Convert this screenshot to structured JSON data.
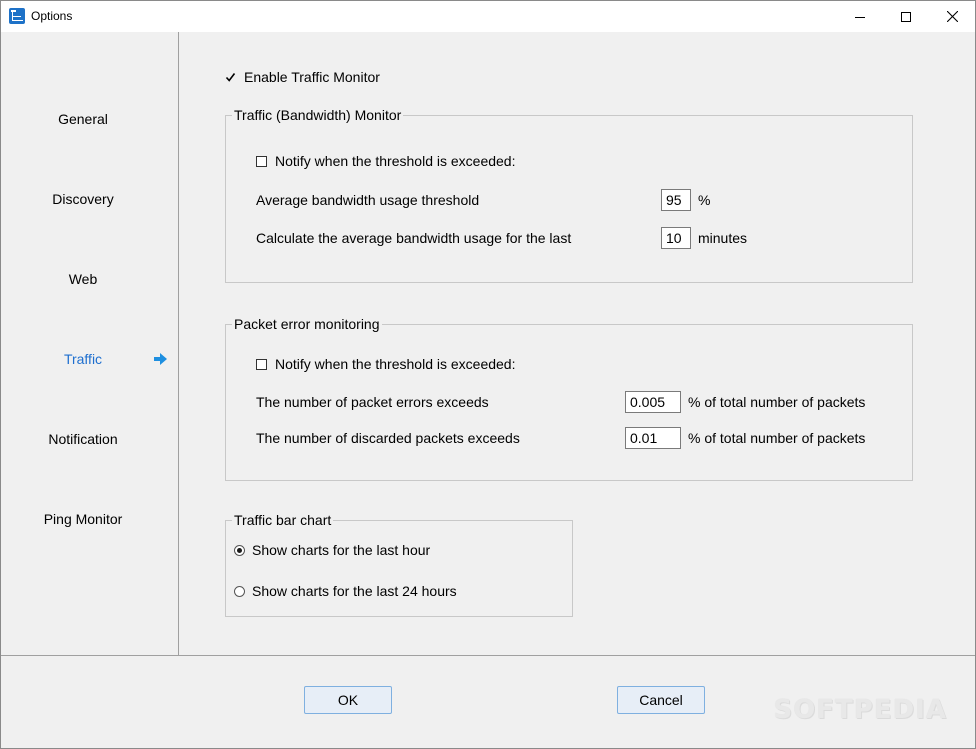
{
  "window": {
    "title": "Options",
    "minimize_icon": "minimize-icon",
    "maximize_icon": "maximize-icon",
    "close_icon": "close-icon"
  },
  "sidebar": {
    "items": [
      {
        "label": "General"
      },
      {
        "label": "Discovery"
      },
      {
        "label": "Web"
      },
      {
        "label": "Traffic",
        "active": true
      },
      {
        "label": "Notification"
      },
      {
        "label": "Ping Monitor"
      }
    ],
    "active_indicator_icon": "arrow-right-icon",
    "active_color": "#1e6fcf"
  },
  "traffic": {
    "enable_label": "Enable Traffic Monitor",
    "enable_checked": true,
    "bandwidth_group": {
      "title": "Traffic (Bandwidth) Monitor",
      "notify_label": "Notify when the threshold is exceeded:",
      "notify_checked": false,
      "avg_threshold_label": "Average bandwidth usage threshold",
      "avg_threshold_value": "95",
      "avg_threshold_unit": "%",
      "avg_period_label": "Calculate the average bandwidth usage for the last",
      "avg_period_value": "10",
      "avg_period_unit": "minutes"
    },
    "packet_group": {
      "title": "Packet error monitoring",
      "notify_label": "Notify when the threshold is exceeded:",
      "notify_checked": false,
      "errors_label": "The number of packet errors exceeds",
      "errors_value": "0.005",
      "errors_unit": "% of total number of packets",
      "discarded_label": "The number of discarded packets exceeds",
      "discarded_value": "0.01",
      "discarded_unit": "% of total number of packets"
    },
    "chart_group": {
      "title": "Traffic bar chart",
      "option_hour": "Show charts for the last hour",
      "option_24h": "Show charts for the last 24 hours",
      "selected": "hour"
    }
  },
  "footer": {
    "ok_label": "OK",
    "cancel_label": "Cancel"
  },
  "watermark": "SOFTPEDIA"
}
